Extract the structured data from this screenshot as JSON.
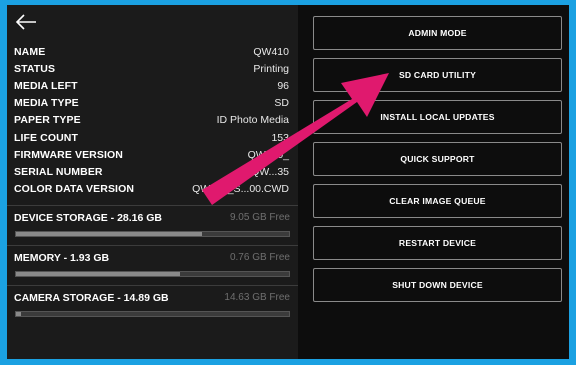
{
  "info": {
    "rows": [
      {
        "label": "NAME",
        "value": "QW410"
      },
      {
        "label": "STATUS",
        "value": "Printing"
      },
      {
        "label": "MEDIA LEFT",
        "value": "96"
      },
      {
        "label": "MEDIA TYPE",
        "value": "SD"
      },
      {
        "label": "PAPER TYPE",
        "value": "ID Photo Media"
      },
      {
        "label": "LIFE COUNT",
        "value": "153"
      },
      {
        "label": "FIRMWARE VERSION",
        "value": "QW410_"
      },
      {
        "label": "SERIAL NUMBER",
        "value": "QW...35"
      },
      {
        "label": "COLOR DATA VERSION",
        "value": "QW410_S...00.CWD"
      }
    ]
  },
  "storage": [
    {
      "label": "DEVICE STORAGE - 28.16 GB",
      "free": "9.05 GB Free",
      "used_fraction": 0.68
    },
    {
      "label": "MEMORY - 1.93 GB",
      "free": "0.76 GB Free",
      "used_fraction": 0.6
    },
    {
      "label": "CAMERA STORAGE - 14.89 GB",
      "free": "14.63 GB Free",
      "used_fraction": 0.02
    }
  ],
  "buttons": {
    "admin_mode": "ADMIN MODE",
    "sd_card_utility": "SD CARD UTILITY",
    "install_local_updates": "INSTALL LOCAL UPDATES",
    "quick_support": "QUICK SUPPORT",
    "clear_image_queue": "CLEAR IMAGE QUEUE",
    "restart_device": "RESTART DEVICE",
    "shut_down_device": "SHUT DOWN DEVICE"
  },
  "colors": {
    "frame": "#1ba1e2",
    "arrow": "#e0196e",
    "panel": "#1b1b1b",
    "background": "#0d0d0d"
  },
  "icons": {
    "back": "back-arrow-icon"
  }
}
